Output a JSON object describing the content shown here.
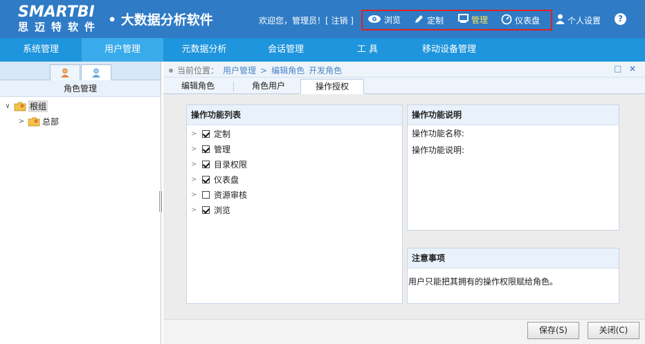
{
  "header": {
    "logo_main": "SMARTBI",
    "logo_sub": "思迈特软件",
    "app_title": "• 大数据分析软件",
    "welcome": "欢迎您，管理员！[ 注销 ]",
    "top_nav": [
      {
        "label": "浏览",
        "icon": "eye-icon"
      },
      {
        "label": "定制",
        "icon": "pencil-icon"
      },
      {
        "label": "管理",
        "icon": "monitor-icon",
        "active": true
      },
      {
        "label": "仪表盘",
        "icon": "dashboard-icon"
      }
    ],
    "personal_settings": "个人设置",
    "help": "?",
    "colors": {
      "header_bg": "#2f7bc6",
      "active_text": "#ffe14d",
      "highlight_border": "#e02020"
    }
  },
  "main_nav": {
    "items": [
      "系统管理",
      "用户管理",
      "元数据分析",
      "会话管理",
      "工 具",
      "移动设备管理"
    ],
    "active": "用户管理"
  },
  "left_panel": {
    "title": "角色管理",
    "tree": [
      {
        "label": "根组",
        "selected": true,
        "expanded": true
      },
      {
        "label": "总部",
        "selected": false,
        "expanded": false
      }
    ]
  },
  "breadcrumb": {
    "prefix": "当前位置：",
    "parts": [
      "用户管理",
      "编辑角色",
      "开发角色"
    ],
    "separator": ">"
  },
  "window_controls": {
    "maximize": "□",
    "close": "×"
  },
  "subtabs": {
    "items": [
      "编辑角色",
      "角色用户",
      "操作授权"
    ],
    "active": "操作授权"
  },
  "func_list": {
    "title": "操作功能列表",
    "items": [
      {
        "label": "定制",
        "checked": true
      },
      {
        "label": "管理",
        "checked": true
      },
      {
        "label": "目录权限",
        "checked": true
      },
      {
        "label": "仪表盘",
        "checked": true
      },
      {
        "label": "资源审核",
        "checked": false
      },
      {
        "label": "浏览",
        "checked": true
      }
    ]
  },
  "func_desc": {
    "title": "操作功能说明",
    "name_label": "操作功能名称:",
    "desc_label": "操作功能说明:"
  },
  "notice": {
    "title": "注意事项",
    "text": "用户只能把其拥有的操作权限赋给角色。"
  },
  "footer": {
    "save": "保存(S)",
    "close": "关闭(C)"
  }
}
